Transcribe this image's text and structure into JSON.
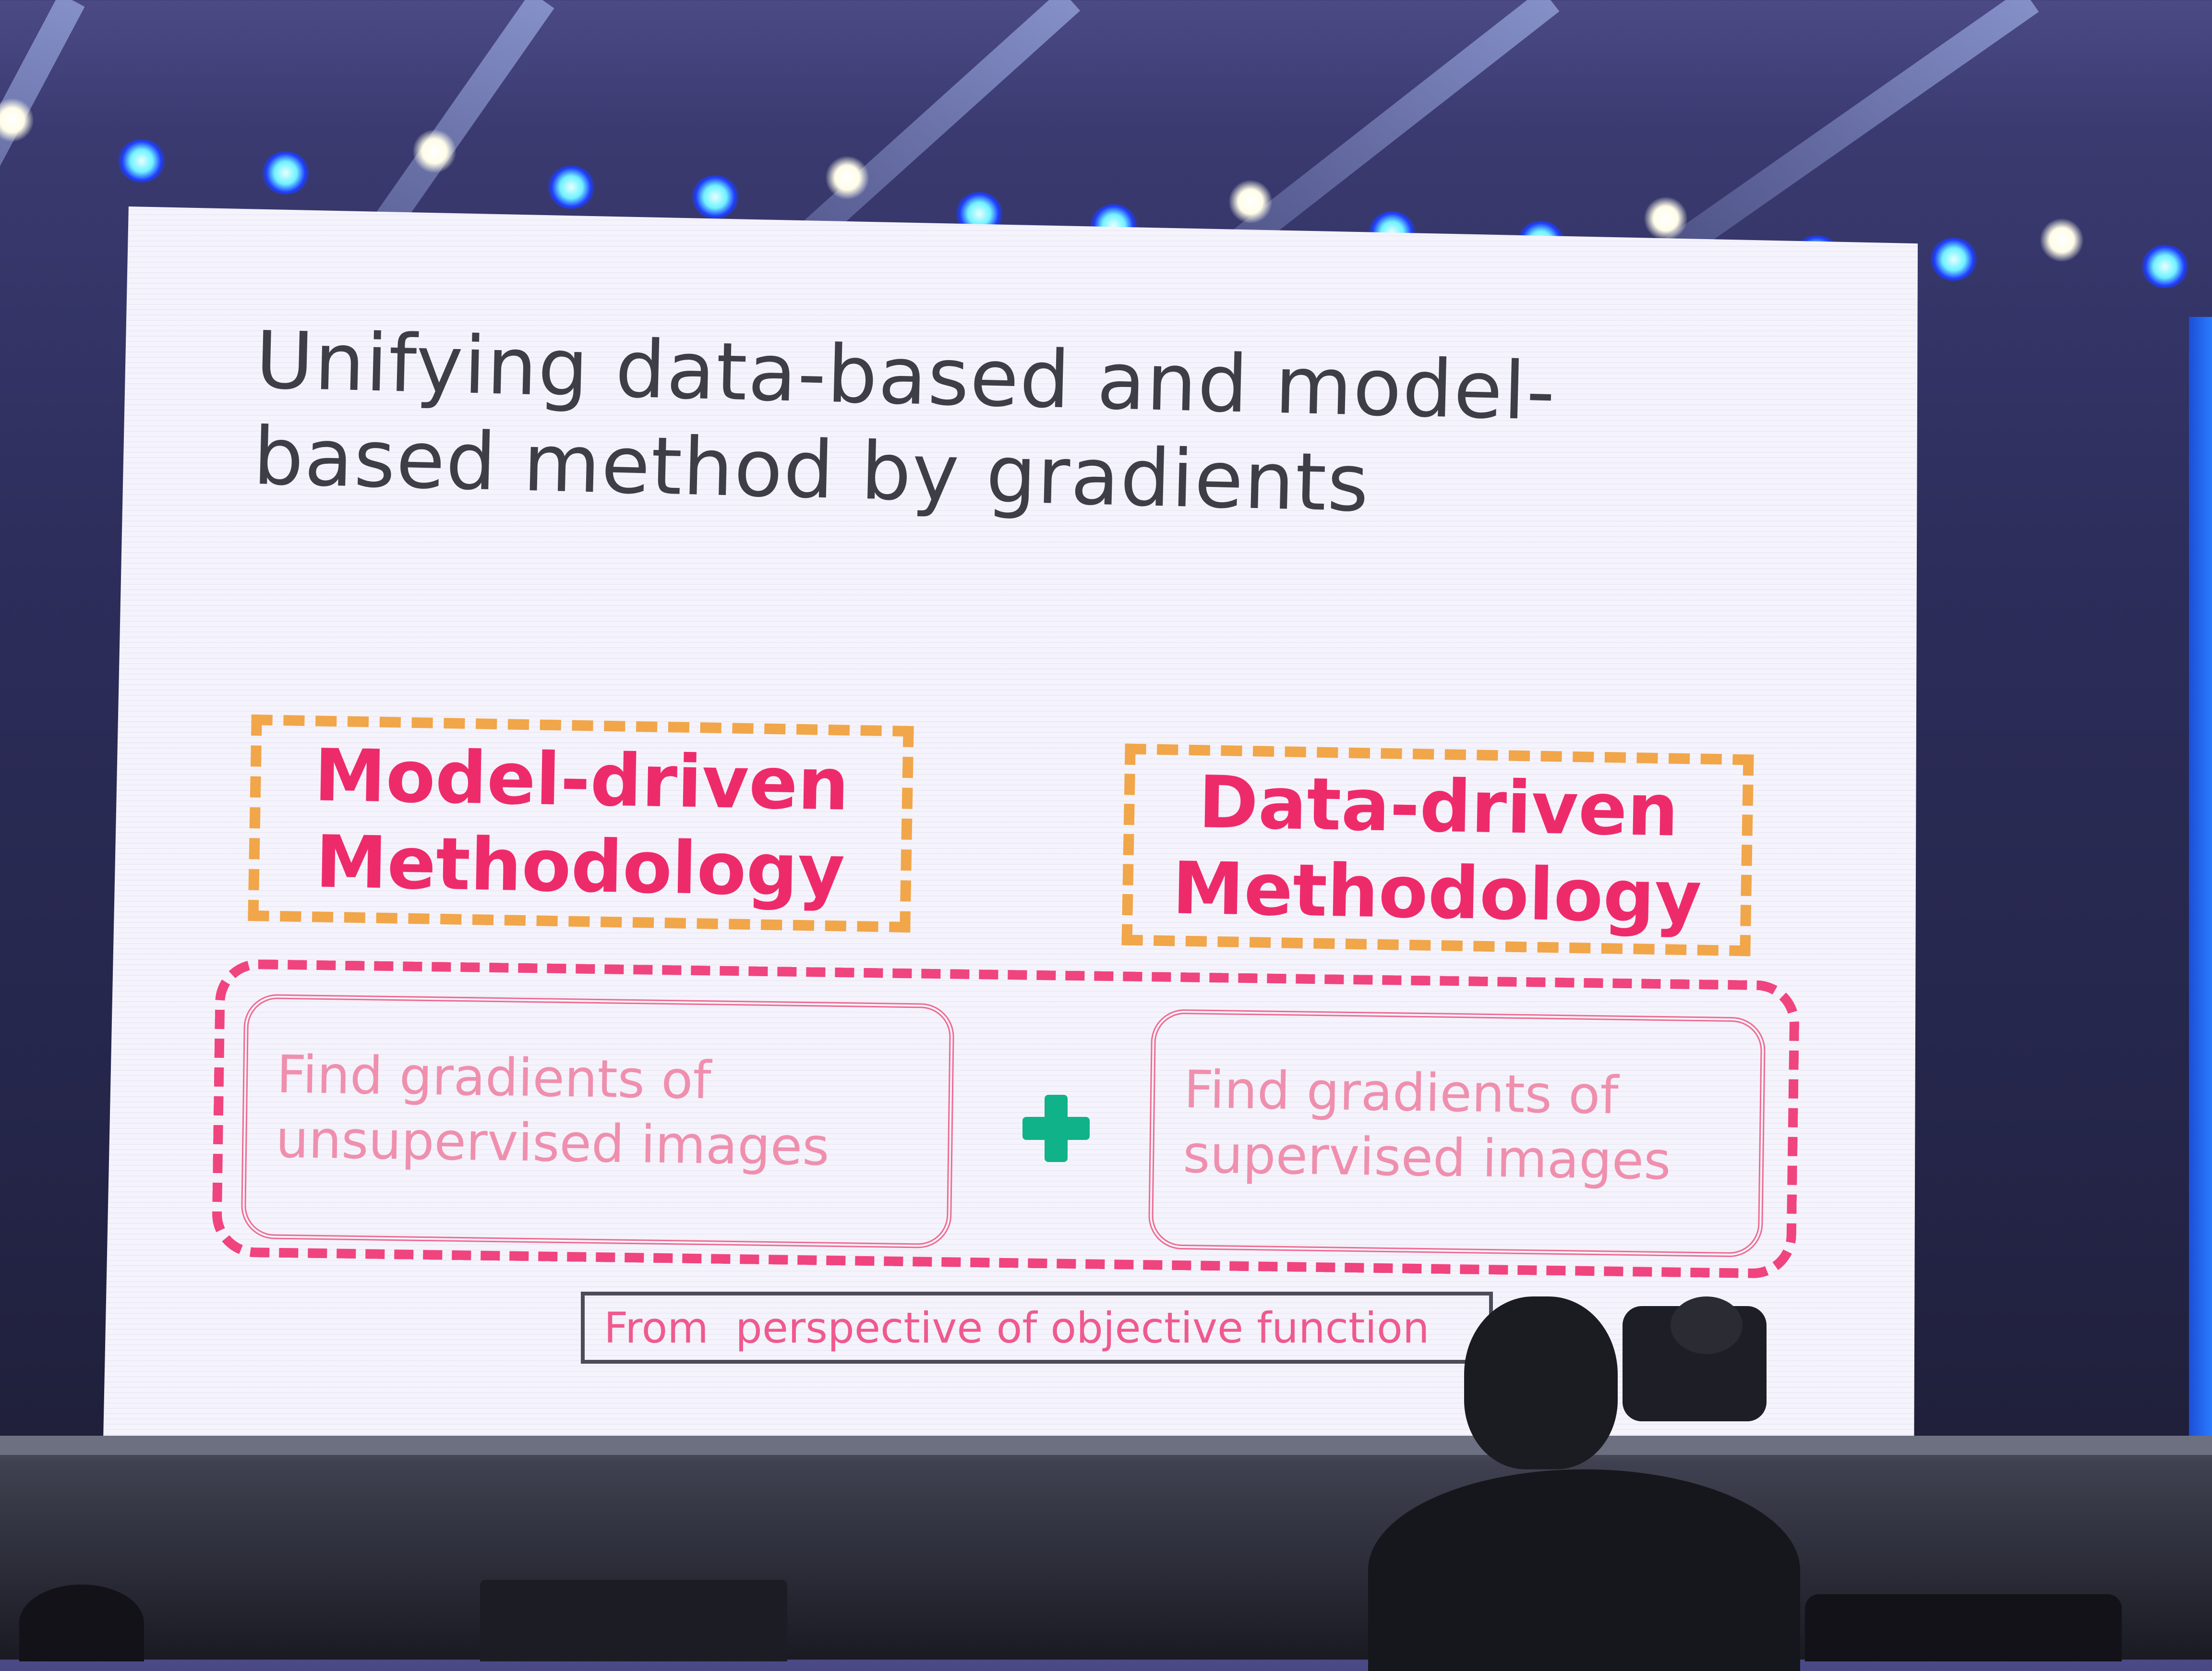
{
  "slide": {
    "title_line1": "Unifying data-based and model-",
    "title_line2": "based method by gradients",
    "model_box": {
      "line1": "Model-driven",
      "line2": "Methodology"
    },
    "data_box": {
      "line1": "Data-driven",
      "line2": "Methodology"
    },
    "left_inner": {
      "line1": "Find gradients of",
      "line2": "unsupervised images"
    },
    "right_inner": {
      "line1": "Find gradients of",
      "line2": "supervised images"
    },
    "caption": "From  perspective of objective function"
  },
  "colors": {
    "title": "#3e3e46",
    "method_text": "#ee2b6a",
    "orange_dash": "#f1a64a",
    "pink_dash": "#f0447f",
    "plus": "#10b28a",
    "stage_blue": "#1f3dff"
  },
  "icons": [
    "plus-icon",
    "stage-light-icon",
    "video-camera-icon"
  ]
}
